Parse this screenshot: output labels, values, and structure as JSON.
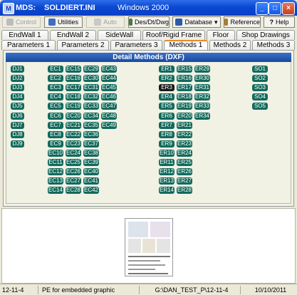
{
  "window": {
    "app_label": "MDS:",
    "file_label": "SOLDIERT.INI",
    "os_label": "Windows 2000",
    "minimize": "_",
    "maximize": "□",
    "close": "×"
  },
  "toolbar": {
    "control": "Control",
    "utilities": "Utilities",
    "auto": "Auto",
    "des_dt_dwg": "Des/Dt/Dwg",
    "database": "Database",
    "reference": "Reference",
    "help": "Help"
  },
  "tabs": {
    "row1": [
      "EndWall 1",
      "EndWall 2",
      "SideWall",
      "Roof/Rigid Frame",
      "Floor",
      "Shop Drawings"
    ],
    "row2": [
      "Parameters 1",
      "Parameters 2",
      "Parameters 3",
      "Methods 1",
      "Methods 2",
      "Methods 3"
    ],
    "active_row2": "Methods 1"
  },
  "panel": {
    "title": "Detail Methods (DXF)",
    "selected": "ER3",
    "dj": [
      "DJ1",
      "DJ2",
      "DJ3",
      "DJ4",
      "DJ5",
      "DJ6",
      "DJ7",
      "DJ8",
      "DJ9"
    ],
    "ec_col1": [
      "EC1",
      "EC2",
      "EC3",
      "EC4",
      "EC5",
      "EC6",
      "EC7",
      "EC8",
      "EC9",
      "EC10",
      "EC11",
      "EC12",
      "EC13",
      "EC14"
    ],
    "ec_col2": [
      "EC15",
      "EC16",
      "EC17",
      "EC18",
      "EC19",
      "EC20",
      "EC21",
      "EC22",
      "EC23",
      "EC24",
      "EC25",
      "EC26",
      "EC27",
      "EC28"
    ],
    "ec_col3": [
      "EC29",
      "EC30",
      "EC31",
      "EC32",
      "EC33",
      "EC34",
      "EC35",
      "EC36",
      "EC37",
      "EC38",
      "EC39",
      "EC40",
      "EC41",
      "EC42"
    ],
    "ec_col4": [
      "EC43",
      "EC44",
      "EC45",
      "EC46",
      "EC47",
      "EC48",
      "EC49"
    ],
    "er_col1": [
      "ER1",
      "ER2",
      "ER3",
      "ER4",
      "ER5",
      "ER6",
      "ER7",
      "ER8",
      "ER9",
      "ER10",
      "ER11",
      "ER12",
      "ER13",
      "ER14"
    ],
    "er_col2": [
      "ER15",
      "ER16",
      "ER17",
      "ER18",
      "ER19",
      "ER20",
      "ER21",
      "ER22",
      "ER23",
      "ER24",
      "ER25",
      "ER26",
      "ER27",
      "ER28"
    ],
    "er_col3": [
      "ER29",
      "ER30",
      "ER31",
      "ER32",
      "ER33",
      "ER34"
    ],
    "so": [
      "SO1",
      "SO2",
      "SO3",
      "SO4",
      "SO5"
    ]
  },
  "status": {
    "left": "12-11-4",
    "hint": "PE for embedded graphic",
    "path": "G:\\DAN_TEST_P\\12-11-4",
    "date": "10/10/2011"
  }
}
